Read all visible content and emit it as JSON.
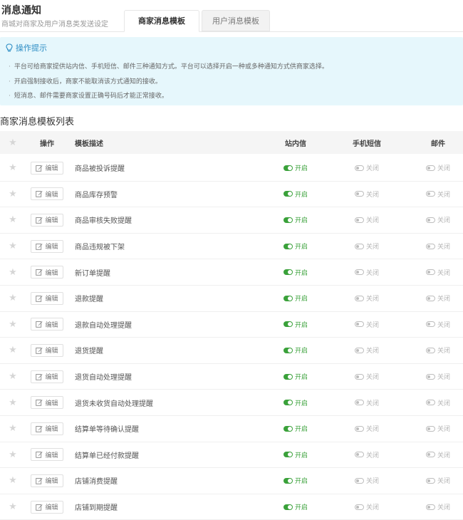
{
  "header": {
    "title": "消息通知",
    "subtitle": "商城对商家及用户消息类发送设定",
    "tabs": [
      {
        "label": "商家消息模板",
        "active": true
      },
      {
        "label": "用户消息模板",
        "active": false
      }
    ]
  },
  "tips": {
    "title": "操作提示",
    "lines": [
      "平台可给商家提供站内信、手机短信、邮件三种通知方式。平台可以选择开启一种或多种通知方式供商家选择。",
      "开启强制接收后，商家不能取消该方式通知的接收。",
      "短消息、邮件需要商家设置正确号码后才能正常接收。"
    ]
  },
  "section_title": "商家消息模板列表",
  "table": {
    "headers": {
      "op": "操作",
      "desc": "模板描述",
      "site": "站内信",
      "sms": "手机短信",
      "mail": "邮件"
    },
    "edit_label": "编辑",
    "on_label": "开启",
    "off_label": "关闭",
    "rows": [
      {
        "desc": "商品被投诉提醒",
        "site": "on",
        "sms": "off",
        "mail": "off"
      },
      {
        "desc": "商品库存预警",
        "site": "on",
        "sms": "off",
        "mail": "off"
      },
      {
        "desc": "商品审核失败提醒",
        "site": "on",
        "sms": "off",
        "mail": "off"
      },
      {
        "desc": "商品违规被下架",
        "site": "on",
        "sms": "off",
        "mail": "off"
      },
      {
        "desc": "新订单提醒",
        "site": "on",
        "sms": "off",
        "mail": "off"
      },
      {
        "desc": "退款提醒",
        "site": "on",
        "sms": "off",
        "mail": "off"
      },
      {
        "desc": "退款自动处理提醒",
        "site": "on",
        "sms": "off",
        "mail": "off"
      },
      {
        "desc": "退货提醒",
        "site": "on",
        "sms": "off",
        "mail": "off"
      },
      {
        "desc": "退货自动处理提醒",
        "site": "on",
        "sms": "off",
        "mail": "off"
      },
      {
        "desc": "退货未收货自动处理提醒",
        "site": "on",
        "sms": "off",
        "mail": "off"
      },
      {
        "desc": "结算单等待确认提醒",
        "site": "on",
        "sms": "off",
        "mail": "off"
      },
      {
        "desc": "结算单已经付款提醒",
        "site": "on",
        "sms": "off",
        "mail": "off"
      },
      {
        "desc": "店铺消费提醒",
        "site": "on",
        "sms": "off",
        "mail": "off"
      },
      {
        "desc": "店铺到期提醒",
        "site": "on",
        "sms": "off",
        "mail": "off"
      }
    ]
  },
  "colors": {
    "on": "#3aa13a",
    "off": "#b5b5b5",
    "tips_bg": "#e6f7fc",
    "tips_title": "#2b8cc4"
  },
  "icons": {
    "tips": "lightbulb-icon",
    "star": "star-icon",
    "edit": "edit-icon"
  }
}
